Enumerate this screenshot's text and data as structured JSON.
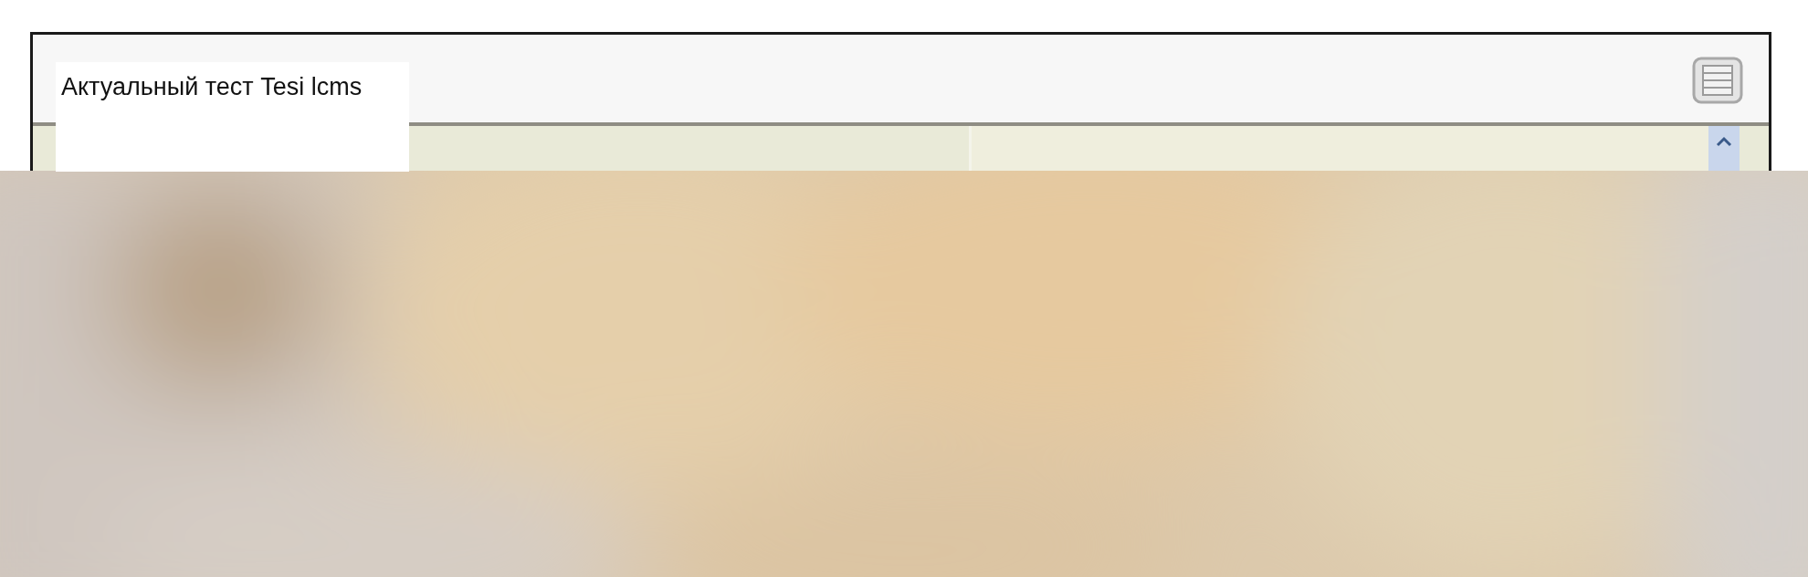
{
  "window": {
    "title": "Актуальный тест Tesi lcms"
  }
}
